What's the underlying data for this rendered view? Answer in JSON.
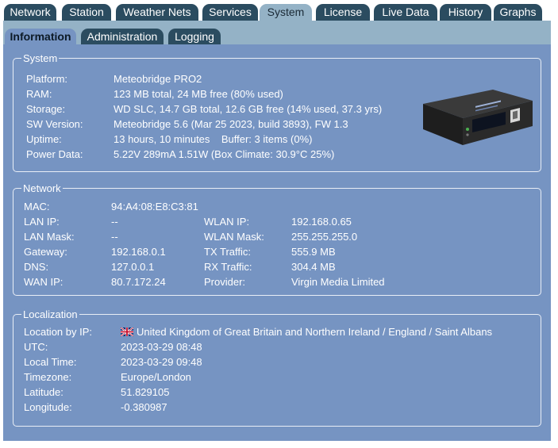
{
  "tabs": [
    "Network",
    "Station",
    "Weather Nets",
    "Services",
    "System",
    "License",
    "Live Data",
    "History",
    "Graphs"
  ],
  "active_tab": "System",
  "subtabs": [
    "Information",
    "Administration",
    "Logging"
  ],
  "active_subtab": "Information",
  "system": {
    "legend": "System",
    "rows": [
      {
        "label": "Platform:",
        "value": "Meteobridge PRO2"
      },
      {
        "label": "RAM:",
        "value": "123 MB total, 24 MB free (80% used)"
      },
      {
        "label": "Storage:",
        "value": "WD SLC, 14.7 GB total, 12.6 GB free (14% used, 37.3 yrs)"
      },
      {
        "label": "SW Version:",
        "value": "Meteobridge 5.6 (Mar 25 2023, build 3893), FW 1.3"
      },
      {
        "label": "Uptime:",
        "value": "13 hours, 10 minutes    Buffer: 3 items (0%)"
      },
      {
        "label": "Power Data:",
        "value": "5.22V 289mA 1.51W (Box Climate: 30.9°C 25%)"
      }
    ]
  },
  "network": {
    "legend": "Network",
    "mac_label": "MAC:",
    "mac_value": "94:A4:08:E8:C3:81",
    "left": [
      {
        "label": "LAN IP:",
        "value": "--"
      },
      {
        "label": "LAN Mask:",
        "value": "--"
      },
      {
        "label": "Gateway:",
        "value": "192.168.0.1"
      },
      {
        "label": "DNS:",
        "value": "127.0.0.1"
      },
      {
        "label": "WAN IP:",
        "value": "80.7.172.24"
      }
    ],
    "right": [
      {
        "label": "WLAN IP:",
        "value": "192.168.0.65"
      },
      {
        "label": "WLAN Mask:",
        "value": "255.255.255.0"
      },
      {
        "label": "TX Traffic:",
        "value": "555.9 MB"
      },
      {
        "label": "RX Traffic:",
        "value": "304.4 MB"
      },
      {
        "label": "Provider:",
        "value": "Virgin Media Limited"
      }
    ]
  },
  "localization": {
    "legend": "Localization",
    "rows": [
      {
        "label": "Location by IP:",
        "value": "United Kingdom of Great Britain and Northern Ireland / England / Saint Albans"
      },
      {
        "label": "UTC:",
        "value": "2023-03-29 08:48"
      },
      {
        "label": "Local Time:",
        "value": "2023-03-29 09:48"
      },
      {
        "label": "Timezone:",
        "value": "Europe/London"
      },
      {
        "label": "Latitude:",
        "value": "51.829105"
      },
      {
        "label": "Longitude:",
        "value": "-0.380987"
      }
    ],
    "flag_icon": "uk-flag-icon"
  },
  "colors": {
    "tab_dark": "#2b4c60",
    "tab_active": "#94b2c6",
    "panel": "#7694c2"
  }
}
